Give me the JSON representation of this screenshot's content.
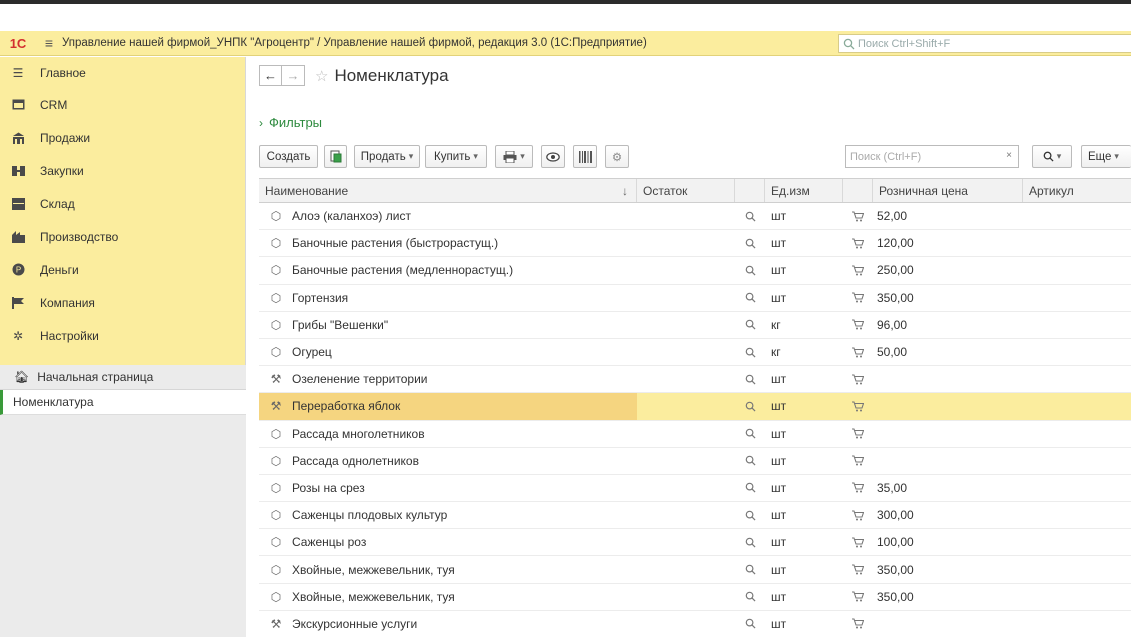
{
  "app": {
    "title": "Управление нашей фирмой_УНПК \"Агроцентр\" / Управление нашей фирмой, редакция 3.0  (1С:Предприятие)",
    "logo": "1С",
    "search_placeholder": "Поиск Ctrl+Shift+F",
    "brand_color": "#fbed9e"
  },
  "sidebar": {
    "sections": [
      {
        "label": "Главное",
        "icon": "menu-icon"
      },
      {
        "label": "CRM",
        "icon": "crm-icon"
      },
      {
        "label": "Продажи",
        "icon": "shop-icon"
      },
      {
        "label": "Закупки",
        "icon": "purchase-icon"
      },
      {
        "label": "Склад",
        "icon": "warehouse-icon"
      },
      {
        "label": "Производство",
        "icon": "factory-icon"
      },
      {
        "label": "Деньги",
        "icon": "money-icon"
      },
      {
        "label": "Компания",
        "icon": "flag-icon"
      },
      {
        "label": "Настройки",
        "icon": "gear-icon"
      }
    ],
    "home": "Начальная страница",
    "open_window": "Номенклатура"
  },
  "page": {
    "title": "Номенклатура",
    "filters": "Фильтры"
  },
  "toolbar": {
    "create": "Создать",
    "sell": "Продать",
    "buy": "Купить",
    "search_placeholder": "Поиск (Ctrl+F)",
    "more": "Еще"
  },
  "table": {
    "columns": {
      "name": "Наименование",
      "stock": "Остаток",
      "unit": "Ед.изм",
      "price": "Розничная цена",
      "article": "Артикул"
    },
    "rows": [
      {
        "name": "Алоэ (каланхоэ) лист",
        "unit": "шт",
        "price": "52,00",
        "type": "product"
      },
      {
        "name": "Баночные растения (быстрорастущ.)",
        "unit": "шт",
        "price": "120,00",
        "type": "product"
      },
      {
        "name": "Баночные растения (медленнорастущ.)",
        "unit": "шт",
        "price": "250,00",
        "type": "product"
      },
      {
        "name": "Гортензия",
        "unit": "шт",
        "price": "350,00",
        "type": "product"
      },
      {
        "name": "Грибы \"Вешенки\"",
        "unit": "кг",
        "price": "96,00",
        "type": "product"
      },
      {
        "name": "Огурец",
        "unit": "кг",
        "price": "50,00",
        "type": "product"
      },
      {
        "name": "Озеленение территории",
        "unit": "шт",
        "price": "",
        "type": "service"
      },
      {
        "name": "Переработка яблок",
        "unit": "шт",
        "price": "",
        "type": "service",
        "selected": true
      },
      {
        "name": "Рассада многолетников",
        "unit": "шт",
        "price": "",
        "type": "product"
      },
      {
        "name": "Рассада однолетников",
        "unit": "шт",
        "price": "",
        "type": "product"
      },
      {
        "name": "Розы на срез",
        "unit": "шт",
        "price": "35,00",
        "type": "product"
      },
      {
        "name": "Саженцы плодовых культур",
        "unit": "шт",
        "price": "300,00",
        "type": "product"
      },
      {
        "name": "Саженцы роз",
        "unit": "шт",
        "price": "100,00",
        "type": "product"
      },
      {
        "name": "Хвойные, межжевельник, туя",
        "unit": "шт",
        "price": "350,00",
        "type": "product"
      },
      {
        "name": "Хвойные, межжевельник, туя",
        "unit": "шт",
        "price": "350,00",
        "type": "product"
      },
      {
        "name": "Экскурсионные услуги",
        "unit": "шт",
        "price": "",
        "type": "service"
      }
    ]
  }
}
